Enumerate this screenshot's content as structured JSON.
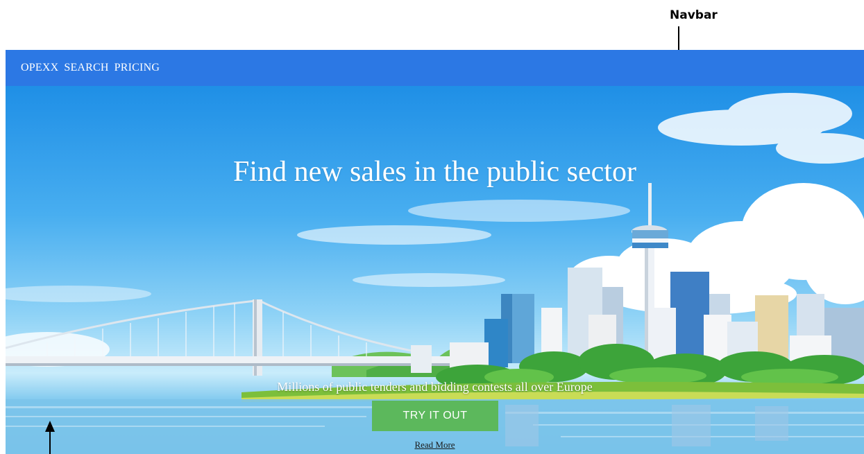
{
  "annotations": {
    "navbar_label": "Navbar"
  },
  "navbar": {
    "brand": "OPEXX",
    "links": [
      "SEARCH",
      "PRICING"
    ],
    "background": "#2c78e4"
  },
  "hero": {
    "title": "Find new sales in the public sector",
    "subtitle": "Millions of public tenders and bidding contests all over Europe",
    "cta_label": "TRY IT OUT",
    "read_more": "Read More",
    "cta_color": "#5cb85c"
  }
}
